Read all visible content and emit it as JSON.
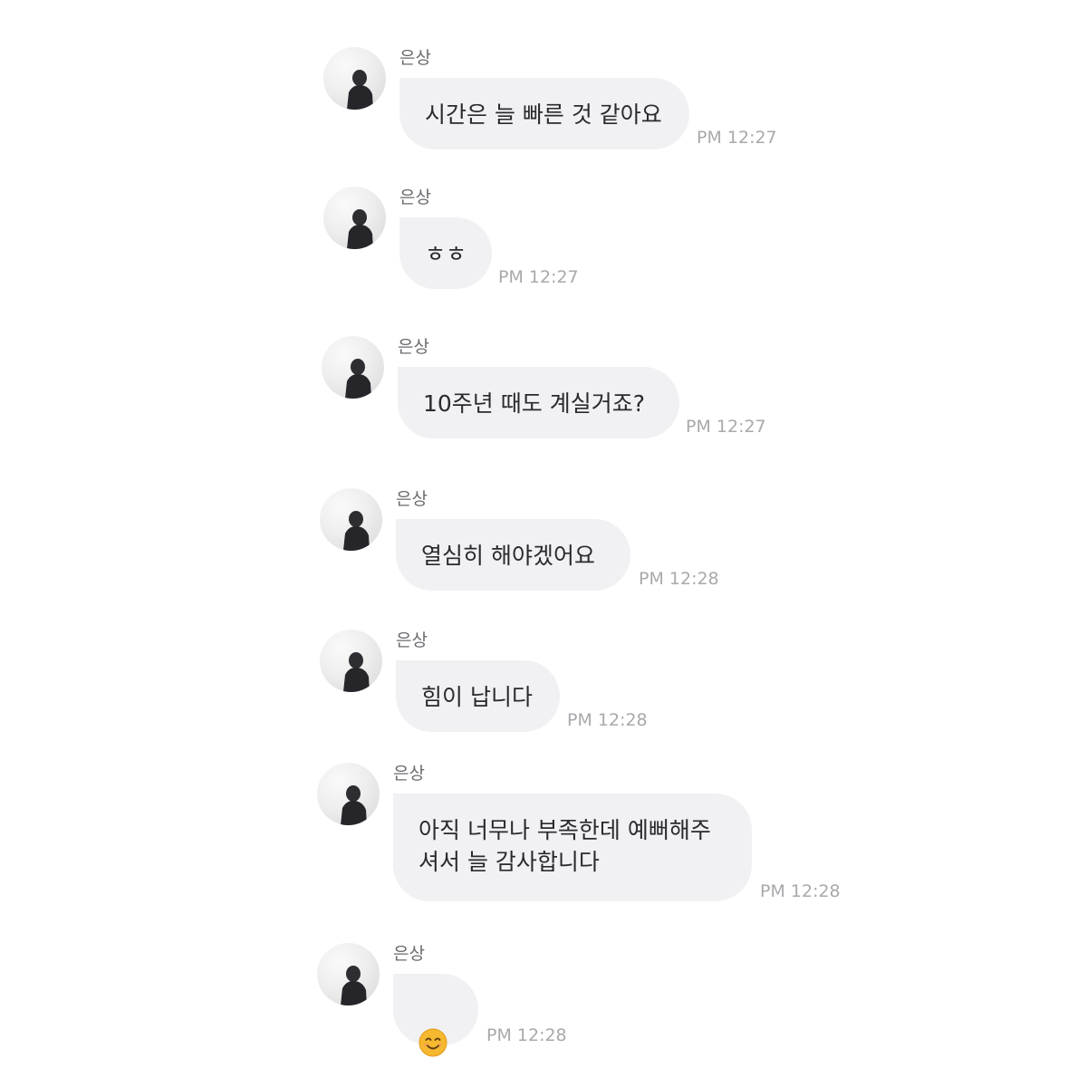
{
  "messages": [
    {
      "sender": "은상",
      "text": "시간은 늘 빠른 것 같아요",
      "time": "PM 12:27"
    },
    {
      "sender": "은상",
      "text": "ㅎㅎ",
      "time": "PM 12:27"
    },
    {
      "sender": "은상",
      "text": "10주년 때도 계실거죠?",
      "time": "PM 12:27"
    },
    {
      "sender": "은상",
      "text": "열심히 해야겠어요",
      "time": "PM 12:28"
    },
    {
      "sender": "은상",
      "text": "힘이 납니다",
      "time": "PM 12:28"
    },
    {
      "sender": "은상",
      "text": "아직 너무나 부족한데 예뻐해주\n셔서 늘 감사합니다",
      "time": "PM 12:28"
    },
    {
      "sender": "은상",
      "emoji": "smiling-face",
      "time": "PM 12:28"
    }
  ],
  "colors": {
    "bubble": "#f1f1f4",
    "text": "#2a2a2e",
    "sender": "#6b6b70",
    "time": "#a9a9ad",
    "emoji": "#f5b82e"
  }
}
